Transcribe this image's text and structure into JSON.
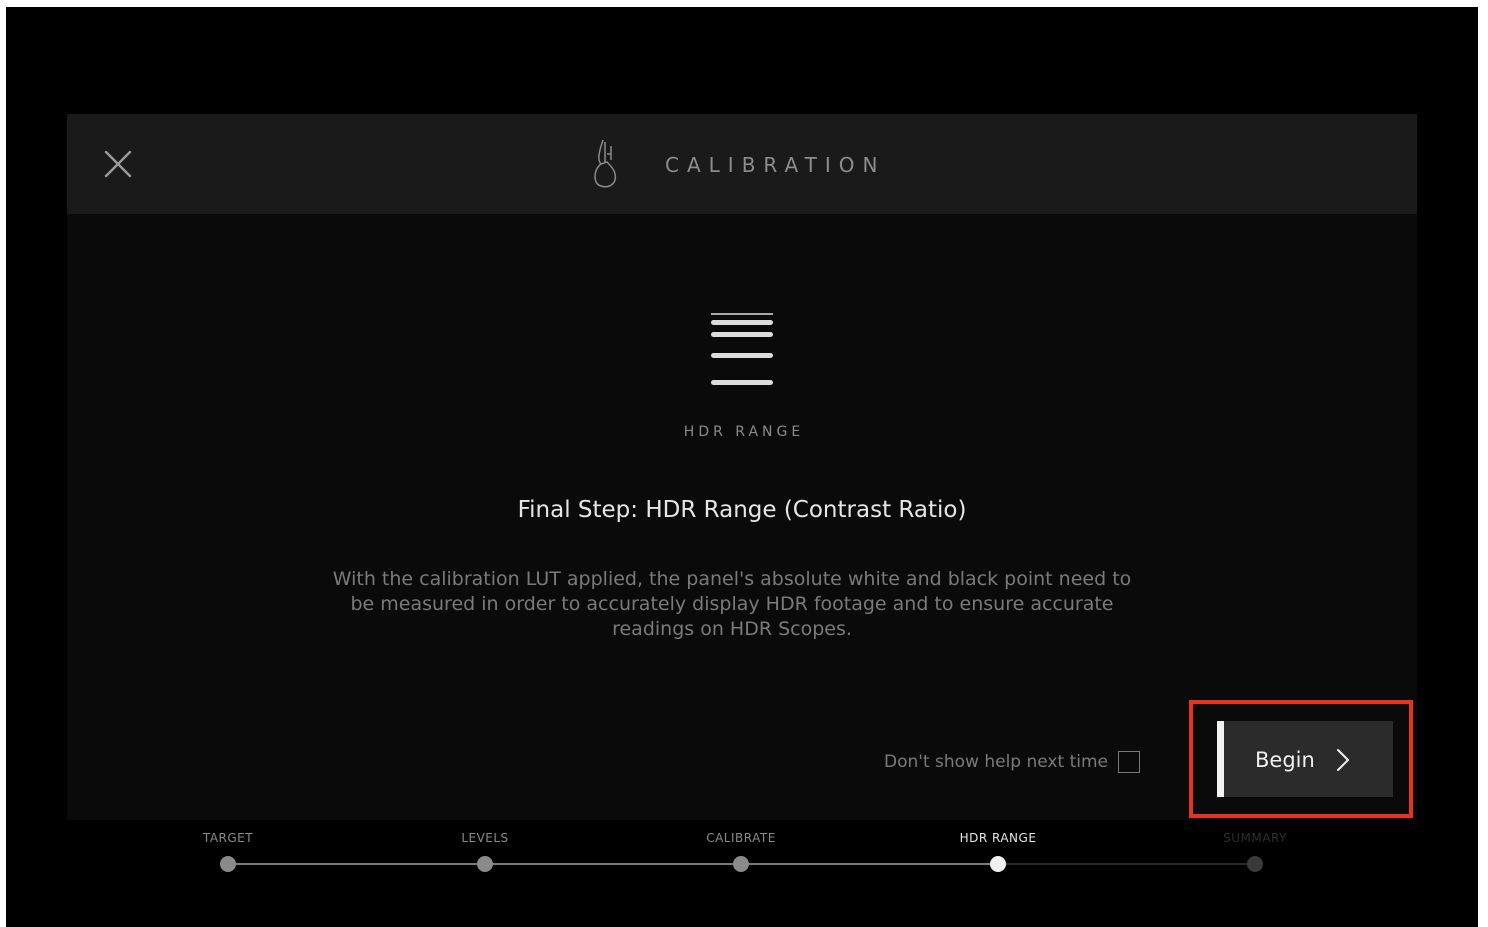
{
  "header": {
    "title": "CALIBRATION",
    "close_icon": "close-icon",
    "logo_icon": "calibration-logo-icon"
  },
  "step": {
    "icon": "hdr-range-icon",
    "icon_label": "HDR RANGE",
    "heading": "Final Step: HDR Range (Contrast Ratio)",
    "body": "With the calibration LUT applied, the panel's absolute white and black point need to be measured in order to accurately display HDR footage and to ensure accurate readings on HDR Scopes."
  },
  "optout": {
    "label": "Don't show help next time",
    "checked": false
  },
  "begin_button": {
    "label": "Begin",
    "icon": "chevron-right-icon"
  },
  "highlight_color": "#e8321e",
  "stepper": {
    "steps": [
      {
        "label": "TARGET",
        "state": "done"
      },
      {
        "label": "LEVELS",
        "state": "done"
      },
      {
        "label": "CALIBRATE",
        "state": "done"
      },
      {
        "label": "HDR RANGE",
        "state": "current"
      },
      {
        "label": "SUMMARY",
        "state": "future"
      }
    ]
  }
}
